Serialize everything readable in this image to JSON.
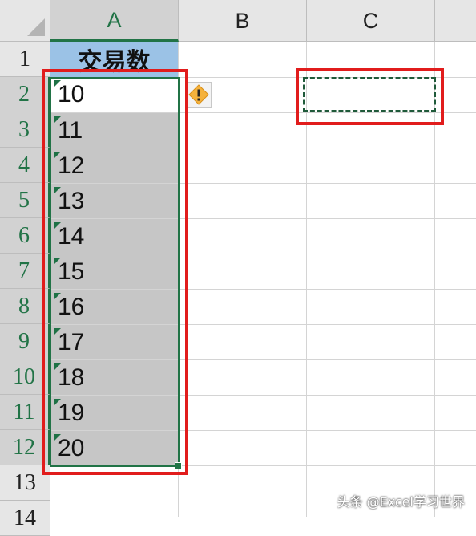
{
  "columns": [
    "A",
    "B",
    "C"
  ],
  "rows": [
    "1",
    "2",
    "3",
    "4",
    "5",
    "6",
    "7",
    "8",
    "9",
    "10",
    "11",
    "12",
    "13",
    "14"
  ],
  "header_cell": "交易数",
  "values": [
    "10",
    "11",
    "12",
    "13",
    "14",
    "15",
    "16",
    "17",
    "18",
    "19",
    "20"
  ],
  "warning_icon": "exclamation-diamond",
  "colors": {
    "selection_accent": "#217346",
    "header_fill": "#9bc2e6",
    "highlight": "#e11c1c"
  },
  "watermark": "头条 @Excel学习世界"
}
